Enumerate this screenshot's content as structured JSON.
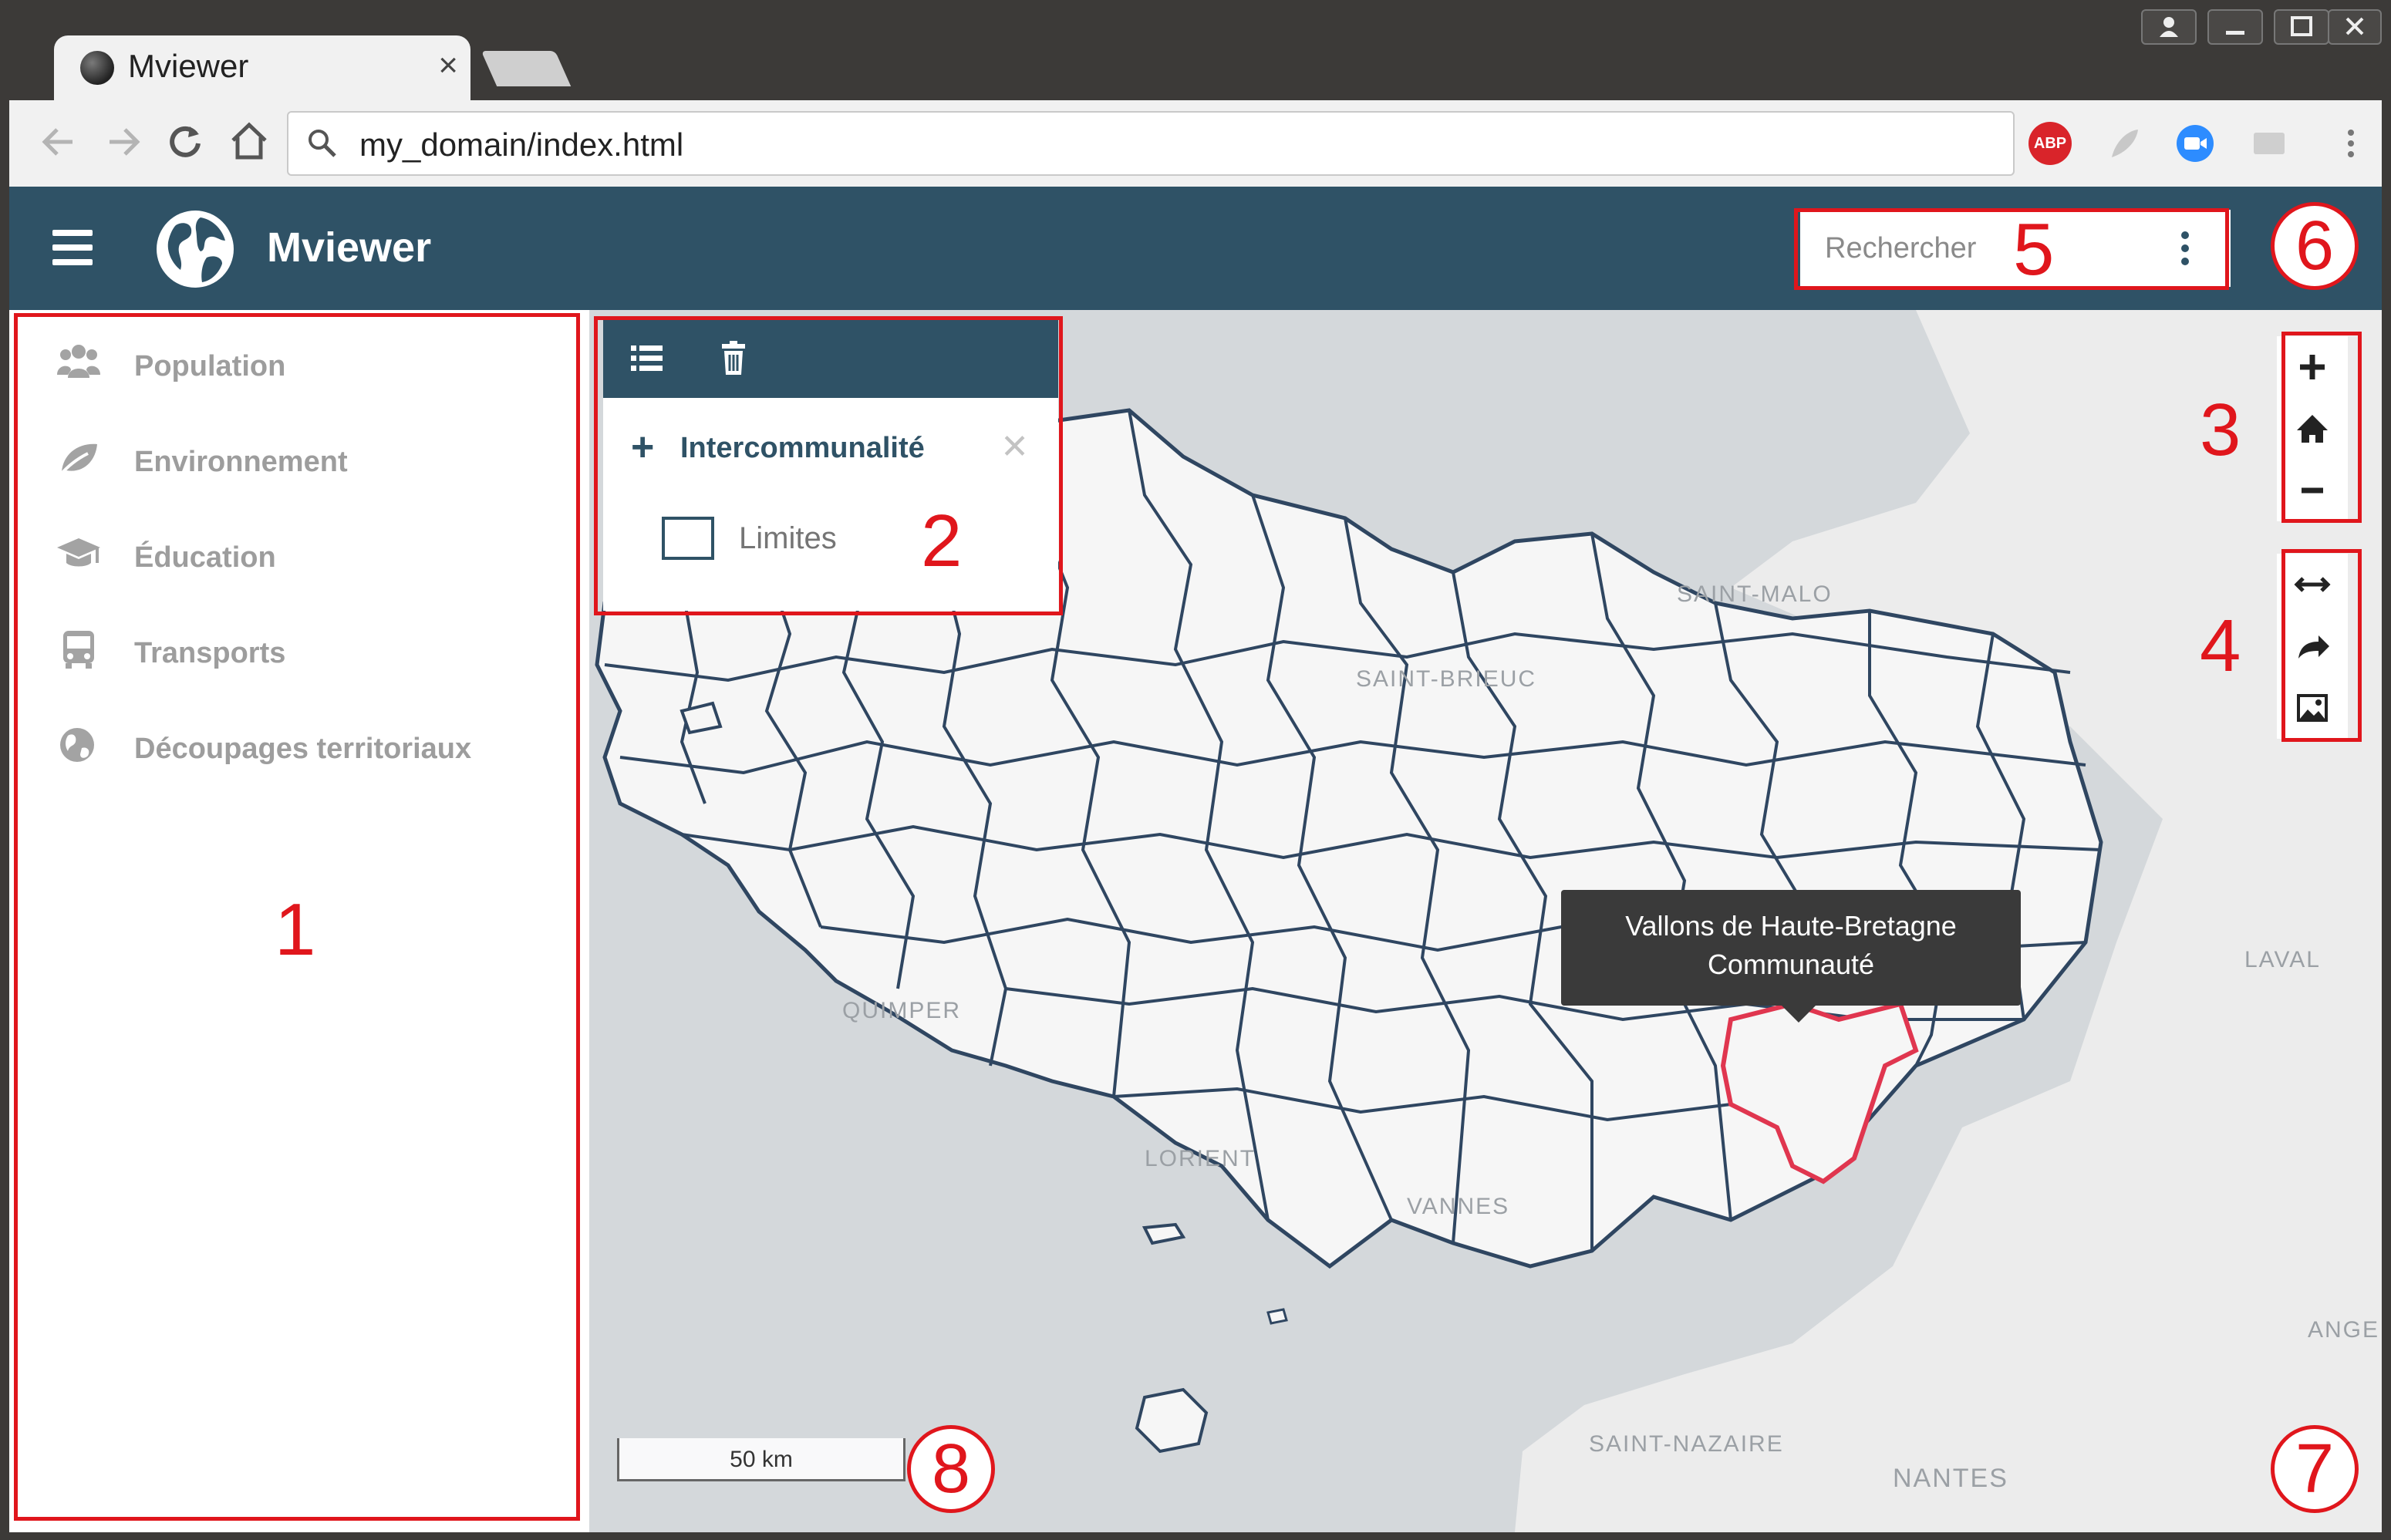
{
  "browser": {
    "tab_title": "Mviewer",
    "tab_close": "×",
    "url": "my_domain/index.html",
    "extensions": [
      "adblock-plus-icon",
      "feather-icon",
      "video-call-icon",
      "cast-icon"
    ],
    "adblock_label": "ABP"
  },
  "header": {
    "title": "Mviewer",
    "search_placeholder": "Rechercher"
  },
  "sidebar": {
    "items": [
      {
        "label": "Population",
        "icon": "users-icon"
      },
      {
        "label": "Environnement",
        "icon": "leaf-icon"
      },
      {
        "label": "Éducation",
        "icon": "graduation-cap-icon"
      },
      {
        "label": "Transports",
        "icon": "bus-icon"
      },
      {
        "label": "Découpages territoriaux",
        "icon": "globe-icon"
      }
    ]
  },
  "layer_panel": {
    "group_label": "Intercommunalité",
    "layer_label": "Limites",
    "layer_checked": false
  },
  "map": {
    "cities": [
      "SAINT-MALO",
      "SAINT-BRIEUC",
      "QUIMPER",
      "LORIENT",
      "VANNES",
      "SAINT-NAZAIRE",
      "NANTES",
      "LAVAL",
      "ANGE"
    ],
    "tooltip_line1": "Vallons de Haute-Bretagne",
    "tooltip_line2": "Communauté",
    "scale_label": "50 km",
    "colors": {
      "water": "#d4d8db",
      "land": "#f6f6f6",
      "boundary": "#2f4661",
      "highlight": "#e0364f"
    }
  },
  "annotations": [
    "1",
    "2",
    "3",
    "4",
    "5",
    "6",
    "7",
    "8"
  ],
  "theme": {
    "header_bg": "#2f5266",
    "annotation": "#e0161c"
  }
}
